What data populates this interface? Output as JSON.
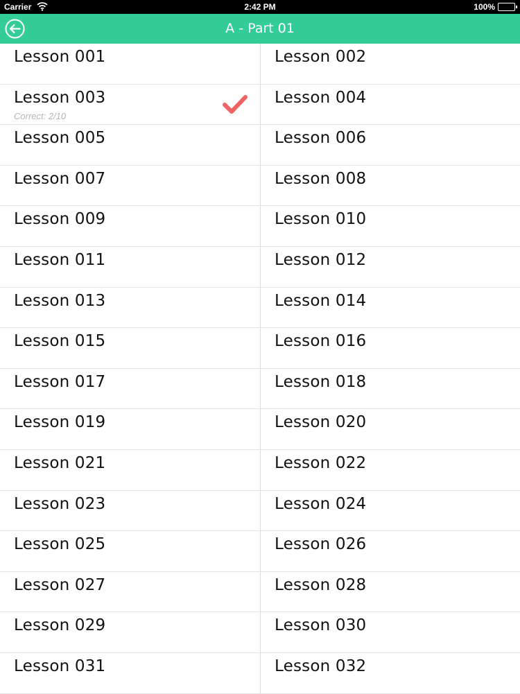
{
  "status_bar": {
    "carrier": "Carrier",
    "time": "2:42 PM",
    "battery": "100%",
    "wifi_icon": "wifi-icon",
    "battery_icon": "battery-icon"
  },
  "nav": {
    "title": "A - Part 01",
    "back_icon": "back-arrow-circle-icon",
    "color": "#34cd98"
  },
  "accent": {
    "check_color": "#f06364"
  },
  "lessons": [
    {
      "label": "Lesson 001"
    },
    {
      "label": "Lesson 002"
    },
    {
      "label": "Lesson 003",
      "sub": "Correct: 2/10",
      "completed": true
    },
    {
      "label": "Lesson 004"
    },
    {
      "label": "Lesson 005"
    },
    {
      "label": "Lesson 006"
    },
    {
      "label": "Lesson 007"
    },
    {
      "label": "Lesson 008"
    },
    {
      "label": "Lesson 009"
    },
    {
      "label": "Lesson 010"
    },
    {
      "label": "Lesson 011"
    },
    {
      "label": "Lesson 012"
    },
    {
      "label": "Lesson 013"
    },
    {
      "label": "Lesson 014"
    },
    {
      "label": "Lesson 015"
    },
    {
      "label": "Lesson 016"
    },
    {
      "label": "Lesson 017"
    },
    {
      "label": "Lesson 018"
    },
    {
      "label": "Lesson 019"
    },
    {
      "label": "Lesson 020"
    },
    {
      "label": "Lesson 021"
    },
    {
      "label": "Lesson 022"
    },
    {
      "label": "Lesson 023"
    },
    {
      "label": "Lesson 024"
    },
    {
      "label": "Lesson 025"
    },
    {
      "label": "Lesson 026"
    },
    {
      "label": "Lesson 027"
    },
    {
      "label": "Lesson 028"
    },
    {
      "label": "Lesson 029"
    },
    {
      "label": "Lesson 030"
    },
    {
      "label": "Lesson 031"
    },
    {
      "label": "Lesson 032"
    }
  ]
}
